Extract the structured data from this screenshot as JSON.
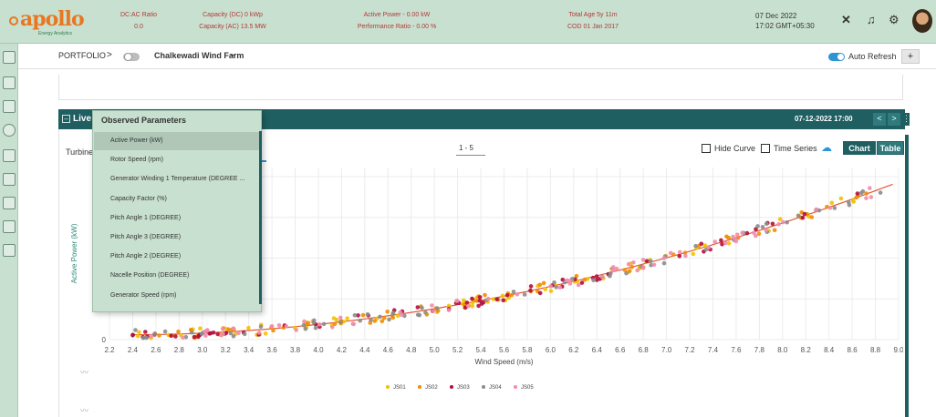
{
  "header": {
    "brand": "apollo",
    "brand_sub": "Energy Analytics",
    "stats": [
      {
        "line1": "DC:AC Ratio",
        "line2": "0.0"
      },
      {
        "line1": "Capacity (DC) 0 kWp",
        "line2": "Capacity (AC) 13.5 MW"
      },
      {
        "line1": "Active Power - 0.00 kW",
        "line2": "Performance Ratio - 0.00 %"
      },
      {
        "line1": "Total Age 5y 11m",
        "line2": "COD 01 Jan 2017"
      }
    ],
    "date": "07 Dec 2022",
    "time": "17:02 GMT+05:30",
    "icons": [
      "expand-icon",
      "bell-icon",
      "gear-icon"
    ]
  },
  "toolbar": {
    "portfolio_label": "PORTFOLIO",
    "chevron": ">",
    "site_name": "Chalkewadi Wind Farm",
    "site_chevron": "⌄",
    "auto_refresh_label": "Auto Refresh",
    "move_icon": "+"
  },
  "panel": {
    "title": "Live",
    "date_label": "07-12-2022 17:00",
    "prev": "<",
    "next": ">",
    "menu": "⋮",
    "turbine_label": "Turbine",
    "range_label": "1 - 5",
    "hide_curve_label": "Hide Curve",
    "time_series_label": "Time Series",
    "chart_btn": "Chart",
    "table_btn": "Table"
  },
  "dropdown": {
    "title": "Observed Parameters",
    "items": [
      "Active Power (kW)",
      "Rotor Speed (rpm)",
      "Generator Winding 1 Temperature (DEGREE ...",
      "Capacity Factor (%)",
      "Pitch Angle 1 (DEGREE)",
      "Pitch Angle 3 (DEGREE)",
      "Pitch Angle 2 (DEGREE)",
      "Nacelle Position (DEGREE)",
      "Generator Speed (rpm)"
    ],
    "active_index": 0
  },
  "chart_data": {
    "type": "scatter",
    "title": "",
    "xlabel": "Wind Speed (m/s)",
    "ylabel": "Active Power (kW)",
    "xlim": [
      2.2,
      9.0
    ],
    "x_ticks": [
      "2.2",
      "2.4",
      "2.6",
      "2.8",
      "3.0",
      "3.2",
      "3.4",
      "3.6",
      "3.8",
      "4.0",
      "4.2",
      "4.4",
      "4.6",
      "4.8",
      "5.0",
      "5.2",
      "5.4",
      "5.6",
      "5.8",
      "6.0",
      "6.2",
      "6.4",
      "6.6",
      "6.8",
      "7.0",
      "7.2",
      "7.4",
      "7.6",
      "7.8",
      "8.0",
      "8.2",
      "8.4",
      "8.6",
      "8.8",
      "9.0"
    ],
    "y_ticks_visible": [
      "0",
      "1",
      "1",
      "2"
    ],
    "legend_position": "bottom",
    "series": [
      {
        "name": "JS01",
        "color": "#f2c200"
      },
      {
        "name": "JS02",
        "color": "#f28c00"
      },
      {
        "name": "JS03",
        "color": "#b0103a"
      },
      {
        "name": "JS04",
        "color": "#8c8c8c"
      },
      {
        "name": "JS05",
        "color": "#f08cae"
      }
    ],
    "trend_points": [
      [
        2.4,
        0.03
      ],
      [
        3.0,
        0.05
      ],
      [
        3.6,
        0.08
      ],
      [
        4.2,
        0.12
      ],
      [
        4.8,
        0.17
      ],
      [
        5.4,
        0.24
      ],
      [
        6.0,
        0.33
      ],
      [
        6.6,
        0.44
      ],
      [
        7.2,
        0.55
      ],
      [
        7.8,
        0.68
      ],
      [
        8.4,
        0.81
      ],
      [
        8.9,
        0.94
      ]
    ]
  }
}
